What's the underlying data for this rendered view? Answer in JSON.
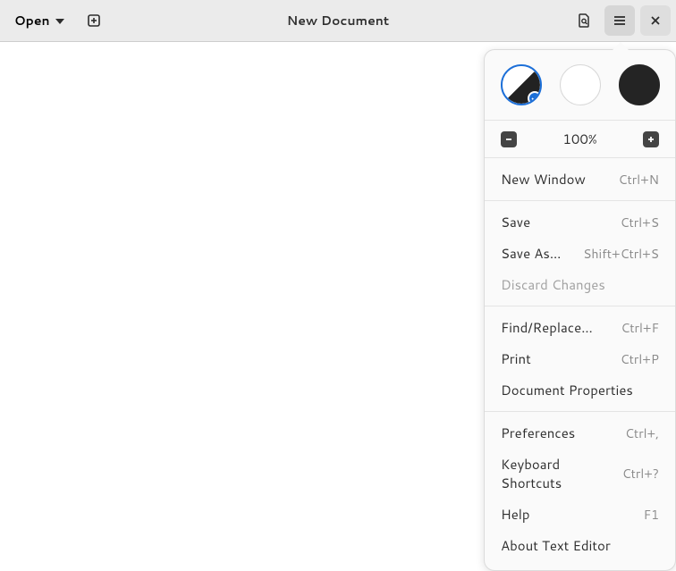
{
  "header": {
    "open_label": "Open",
    "title": "New Document"
  },
  "popover": {
    "zoom": {
      "value": "100%"
    },
    "groups": [
      [
        {
          "label": "New Window",
          "shortcut": "Ctrl+N",
          "disabled": false
        }
      ],
      [
        {
          "label": "Save",
          "shortcut": "Ctrl+S",
          "disabled": false
        },
        {
          "label": "Save As…",
          "shortcut": "Shift+Ctrl+S",
          "disabled": false
        },
        {
          "label": "Discard Changes",
          "shortcut": "",
          "disabled": true
        }
      ],
      [
        {
          "label": "Find/Replace…",
          "shortcut": "Ctrl+F",
          "disabled": false
        },
        {
          "label": "Print",
          "shortcut": "Ctrl+P",
          "disabled": false
        },
        {
          "label": "Document Properties",
          "shortcut": "",
          "disabled": false
        }
      ],
      [
        {
          "label": "Preferences",
          "shortcut": "Ctrl+,",
          "disabled": false
        },
        {
          "label": "Keyboard Shortcuts",
          "shortcut": "Ctrl+?",
          "disabled": false
        },
        {
          "label": "Help",
          "shortcut": "F1",
          "disabled": false
        },
        {
          "label": "About Text Editor",
          "shortcut": "",
          "disabled": false
        }
      ]
    ]
  }
}
